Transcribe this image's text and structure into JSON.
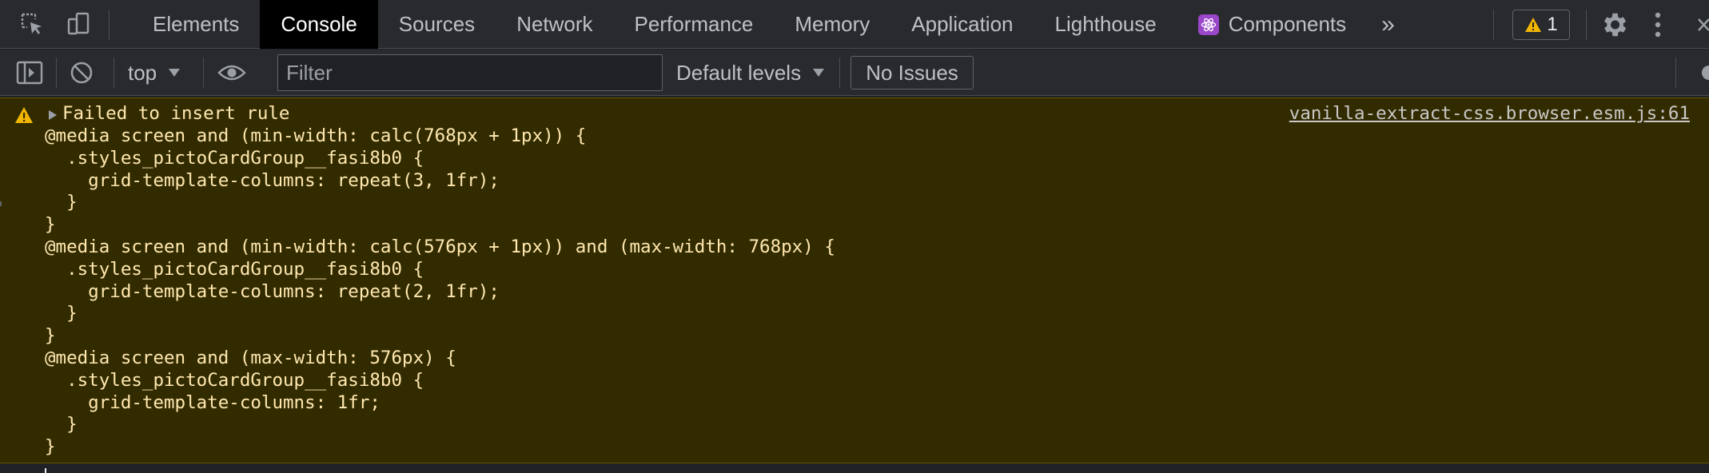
{
  "tabbar": {
    "tabs": [
      {
        "label": "Elements",
        "active": false
      },
      {
        "label": "Console",
        "active": true
      },
      {
        "label": "Sources",
        "active": false
      },
      {
        "label": "Network",
        "active": false
      },
      {
        "label": "Performance",
        "active": false
      },
      {
        "label": "Memory",
        "active": false
      },
      {
        "label": "Application",
        "active": false
      },
      {
        "label": "Lighthouse",
        "active": false
      },
      {
        "label": "Components",
        "active": false
      }
    ],
    "more_tabs_label": "»",
    "warning_count": "1",
    "icons": [
      "inspect-icon",
      "device-toolbar-icon",
      "settings-gear-icon",
      "more-vertical-icon"
    ]
  },
  "toolbar": {
    "context": "top",
    "filter_placeholder": "Filter",
    "filter_value": "",
    "levels_label": "Default levels",
    "issues_label": "No Issues",
    "icons": [
      "sidebar-toggle-icon",
      "clear-console-icon",
      "eye-icon"
    ]
  },
  "message": {
    "level": "warning",
    "title": "Failed to insert rule",
    "source_link": "vanilla-extract-css.browser.esm.js:61",
    "code_lines": [
      "@media screen and (min-width: calc(768px + 1px)) {",
      "  .styles_pictoCardGroup__fasi8b0 {",
      "    grid-template-columns: repeat(3, 1fr);",
      "  }",
      "}",
      "@media screen and (min-width: calc(576px + 1px)) and (max-width: 768px) {",
      "  .styles_pictoCardGroup__fasi8b0 {",
      "    grid-template-columns: repeat(2, 1fr);",
      "  }",
      "}",
      "@media screen and (max-width: 576px) {",
      "  .styles_pictoCardGroup__fasi8b0 {",
      "    grid-template-columns: 1fr;",
      "  }",
      "}"
    ]
  },
  "colors": {
    "panel_bg": "#292a2d",
    "warning_bg": "#332b00",
    "warning_text": "#ffe8b0",
    "warning_icon": "#f2b600",
    "react_badge": "#9a46c9"
  }
}
